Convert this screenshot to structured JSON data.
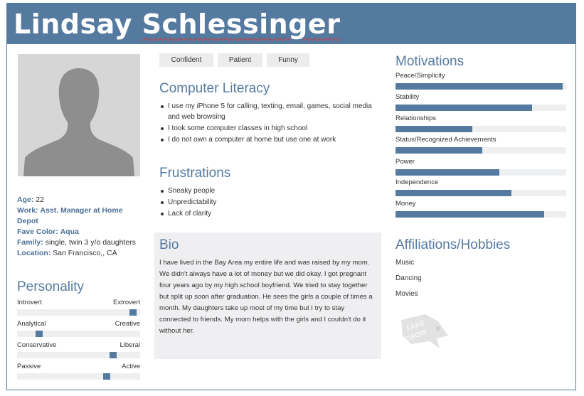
{
  "name": "Lindsay Schlessinger",
  "name_first": "Lindsay",
  "name_last": "Schlessinger",
  "details": {
    "age_label": "Age:",
    "age": "22",
    "work_label": "Work:",
    "work": "Asst. Manager at Home Depot",
    "color_label": "Fave Color:",
    "color": "Aqua",
    "family_label": "Family:",
    "family": "single, twin 3 y/o daughters",
    "location_label": "Location:",
    "location": "San Francisco,, CA"
  },
  "personality": {
    "title": "Personality",
    "sliders": [
      {
        "left": "Introvert",
        "right": "Extrovert",
        "level": 0.97
      },
      {
        "left": "Analytical",
        "right": "Creative",
        "level": 0.16
      },
      {
        "left": "Conservative",
        "right": "Liberal",
        "level": 0.8
      },
      {
        "left": "Passive",
        "right": "Active",
        "level": 0.74
      }
    ]
  },
  "tags": [
    "Confident",
    "Patient",
    "Funny"
  ],
  "computer_literacy": {
    "title": "Computer Literacy",
    "items": [
      "I use my iPhone 5 for calling, texting, email, games, social media and web browsing",
      "I took some computer classes in high school",
      "I do not own a computer at home but use one at work"
    ]
  },
  "frustrations": {
    "title": "Frustrations",
    "items": [
      "Sneaky people",
      "Unpredictability",
      "Lack of clarity"
    ]
  },
  "bio": {
    "title": "Bio",
    "text": "I have lived in the Bay Area my entire life and was raised by my mom. We didn't always have a lot of money but we did okay. I got pregnant four years ago by my high school boyfriend. We tried to stay together but split up soon after graduation. He sees the girls a couple of times a month. My daughters take up most of my time but I  try to stay connected to friends. My mom helps with the girls and I couldn't do it without her."
  },
  "motivations": {
    "title": "Motivations",
    "items": [
      {
        "label": "Peace/Simplicity",
        "level": 0.98
      },
      {
        "label": "Stability",
        "level": 0.8
      },
      {
        "label": "Relationships",
        "level": 0.45
      },
      {
        "label": "Status/Recognized Achievements",
        "level": 0.51
      },
      {
        "label": "Power",
        "level": 0.61
      },
      {
        "label": "Independence",
        "level": 0.68
      },
      {
        "label": "Money",
        "level": 0.87
      }
    ]
  },
  "affiliations": {
    "title": "Affiliations/Hobbies",
    "items": [
      "Music",
      "Dancing",
      "Movies"
    ]
  },
  "logo_text": "FAKE CROW",
  "colors": {
    "accent": "#557aa0",
    "track": "#eeeff1",
    "panel": "#efeff1"
  }
}
